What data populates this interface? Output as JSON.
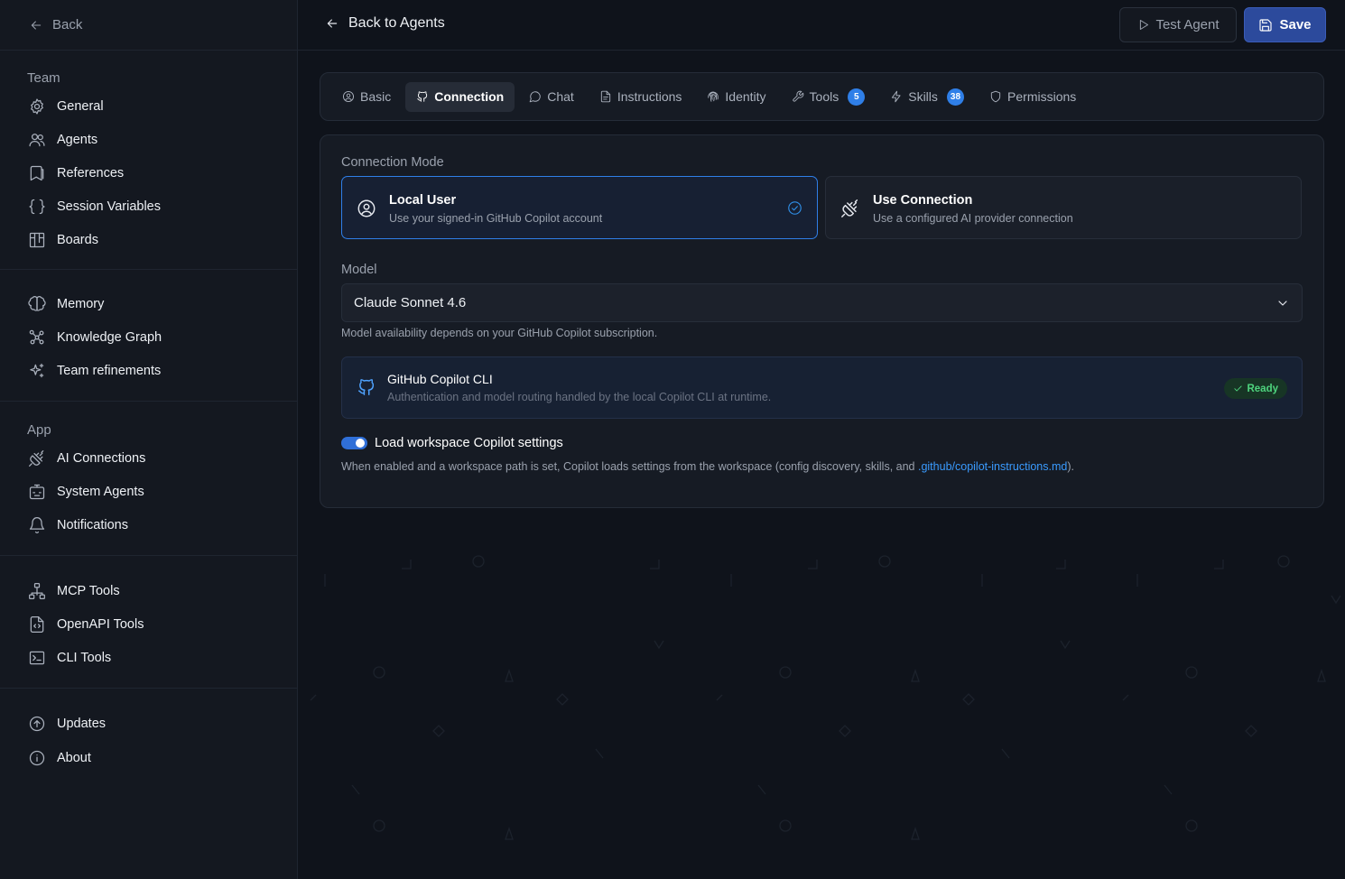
{
  "sidebar": {
    "back_label": "Back",
    "team_heading": "Team",
    "team_items": [
      {
        "label": "General",
        "icon": "gear-icon"
      },
      {
        "label": "Agents",
        "icon": "users-icon"
      },
      {
        "label": "References",
        "icon": "bookmark-icon"
      },
      {
        "label": "Session Variables",
        "icon": "braces-icon"
      },
      {
        "label": "Boards",
        "icon": "kanban-icon"
      }
    ],
    "knowledge_items": [
      {
        "label": "Memory",
        "icon": "brain-icon"
      },
      {
        "label": "Knowledge Graph",
        "icon": "graph-icon"
      },
      {
        "label": "Team refinements",
        "icon": "sparkles-icon"
      }
    ],
    "app_heading": "App",
    "app_items": [
      {
        "label": "AI Connections",
        "icon": "plug-icon"
      },
      {
        "label": "System Agents",
        "icon": "bot-icon"
      },
      {
        "label": "Notifications",
        "icon": "bell-icon"
      }
    ],
    "tool_items": [
      {
        "label": "MCP Tools",
        "icon": "network-icon"
      },
      {
        "label": "OpenAPI Tools",
        "icon": "file-code-icon"
      },
      {
        "label": "CLI Tools",
        "icon": "terminal-icon"
      }
    ],
    "misc_items": [
      {
        "label": "Updates",
        "icon": "arrow-up-circle-icon"
      },
      {
        "label": "About",
        "icon": "info-icon"
      }
    ]
  },
  "header": {
    "back_label": "Back to Agents",
    "test_label": "Test Agent",
    "save_label": "Save"
  },
  "tabs": [
    {
      "label": "Basic",
      "icon": "user-circle-icon",
      "active": false
    },
    {
      "label": "Connection",
      "icon": "github-icon",
      "active": true
    },
    {
      "label": "Chat",
      "icon": "chat-icon",
      "active": false
    },
    {
      "label": "Instructions",
      "icon": "file-icon",
      "active": false
    },
    {
      "label": "Identity",
      "icon": "fingerprint-icon",
      "active": false
    },
    {
      "label": "Tools",
      "icon": "wrench-icon",
      "active": false,
      "badge": "5"
    },
    {
      "label": "Skills",
      "icon": "zap-icon",
      "active": false,
      "badge": "38"
    },
    {
      "label": "Permissions",
      "icon": "shield-icon",
      "active": false
    }
  ],
  "connection": {
    "mode_label": "Connection Mode",
    "modes": [
      {
        "title": "Local User",
        "subtitle": "Use your signed-in GitHub Copilot account",
        "selected": true
      },
      {
        "title": "Use Connection",
        "subtitle": "Use a configured AI provider connection",
        "selected": false
      }
    ],
    "model_label": "Model",
    "model_value": "Claude Sonnet 4.6",
    "model_help": "Model availability depends on your GitHub Copilot subscription.",
    "cli": {
      "title": "GitHub Copilot CLI",
      "subtitle": "Authentication and model routing handled by the local Copilot CLI at runtime.",
      "status": "Ready"
    },
    "workspace_toggle": {
      "label": "Load workspace Copilot settings",
      "enabled": true,
      "help_prefix": "When enabled and a workspace path is set, Copilot loads settings from the workspace (config discovery, skills, and ",
      "help_link": ".github/copilot-instructions.md",
      "help_suffix": ")."
    }
  },
  "colors": {
    "accent": "#2f7fe8",
    "save_button": "#2c4a9c",
    "ready_green": "#4ed47e",
    "background": "#0f131b"
  }
}
